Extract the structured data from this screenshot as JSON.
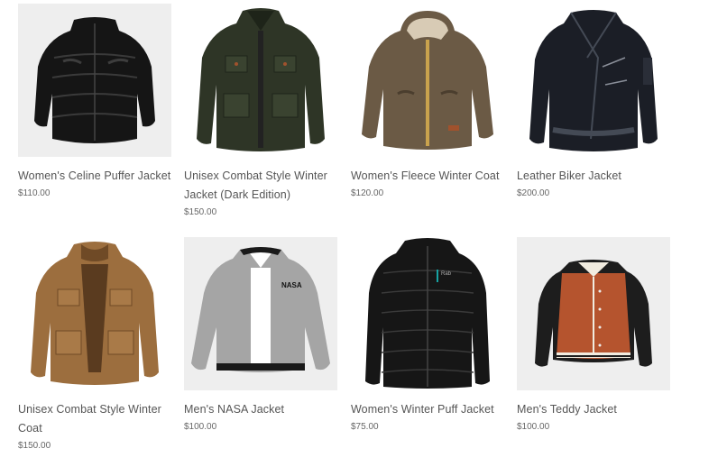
{
  "products": [
    {
      "name": "Women's Celine Puffer Jacket",
      "price": "$110.00",
      "icon": "black-puffer-jacket-image",
      "bg": "#eeeeee"
    },
    {
      "name": "Unisex Combat Style Winter Jacket (Dark Edition)",
      "price": "$150.00",
      "icon": "dark-green-combat-jacket-image",
      "bg": "#ffffff"
    },
    {
      "name": "Women's Fleece Winter Coat",
      "price": "$120.00",
      "icon": "brown-fleece-coat-image",
      "bg": "#ffffff"
    },
    {
      "name": "Leather Biker Jacket",
      "price": "$200.00",
      "icon": "black-leather-biker-jacket-image",
      "bg": "#ffffff"
    },
    {
      "name": "Unisex Combat Style Winter Coat",
      "price": "$150.00",
      "icon": "tan-combat-coat-image",
      "bg": "#ffffff"
    },
    {
      "name": "Men's NASA Jacket",
      "price": "$100.00",
      "icon": "gray-nasa-bomber-jacket-image",
      "bg": "#eeeeee",
      "logo_text": "NASA"
    },
    {
      "name": "Women's Winter Puff Jacket",
      "price": "$75.00",
      "icon": "black-puff-jacket-image",
      "bg": "#ffffff",
      "logo_text": "Rab"
    },
    {
      "name": "Men's Teddy Jacket",
      "price": "$100.00",
      "icon": "varsity-teddy-jacket-image",
      "bg": "#eeeeee"
    }
  ]
}
